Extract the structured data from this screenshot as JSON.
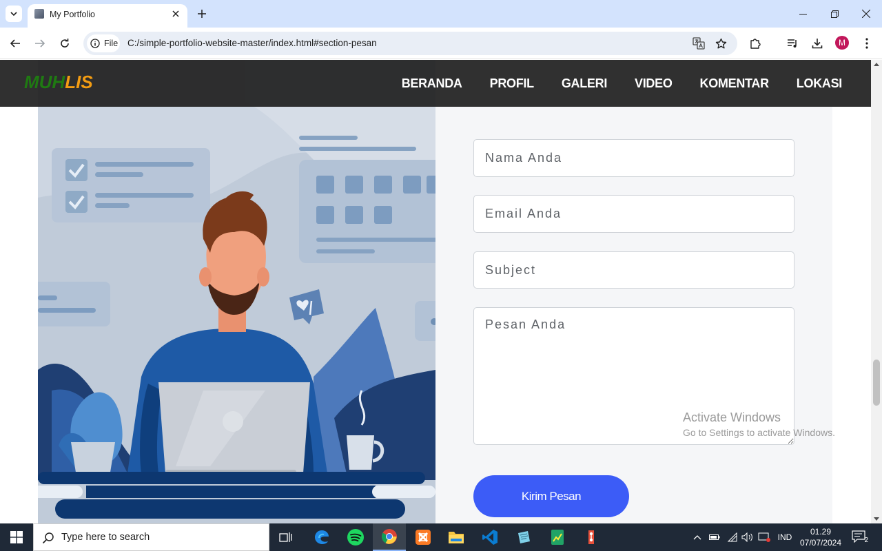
{
  "browser": {
    "tab_title": "My Portfolio",
    "site_chip_label": "File",
    "url": "C:/simple-portfolio-website-master/index.html#section-pesan",
    "profile_initial": "M"
  },
  "site": {
    "logo_part1": "MUH",
    "logo_part2": "LIS",
    "nav": [
      "BERANDA",
      "PROFIL",
      "GALERI",
      "VIDEO",
      "KOMENTAR",
      "LOKASI"
    ]
  },
  "form": {
    "name_placeholder": "Nama Anda",
    "email_placeholder": "Email Anda",
    "subject_placeholder": "Subject",
    "message_placeholder": "Pesan Anda",
    "submit_label": "Kirim Pesan"
  },
  "watermark": {
    "title": "Activate Windows",
    "subtitle": "Go to Settings to activate Windows."
  },
  "taskbar": {
    "search_placeholder": "Type here to search",
    "language": "IND",
    "time": "01.29",
    "date": "07/07/2024",
    "notification_count": "2"
  },
  "colors": {
    "nav_background": "#202020",
    "logo_green": "#1f7a12",
    "logo_orange": "#f39c12",
    "submit_button": "#3c5cf7",
    "form_panel": "#f5f6f8",
    "chrome_tabbar": "#d3e3fd",
    "taskbar": "#1f2937"
  },
  "icons": {
    "tabbar": [
      "tab-list-icon",
      "favicon-icon",
      "close-icon",
      "plus-icon",
      "minimize-icon",
      "maximize-icon",
      "window-close-icon"
    ],
    "toolbar": [
      "back-icon",
      "forward-icon",
      "reload-icon",
      "info-icon",
      "translate-icon",
      "star-icon",
      "extensions-icon",
      "media-icon",
      "download-icon",
      "menu-icon"
    ],
    "taskbar": [
      "windows-icon",
      "search-icon",
      "task-view-icon",
      "edge-icon",
      "spotify-icon",
      "chrome-icon",
      "xampp-icon",
      "file-explorer-icon",
      "vscode-icon",
      "notepad-icon",
      "sheets-icon",
      "git-icon",
      "chevron-up-icon",
      "battery-icon",
      "wifi-icon",
      "volume-icon",
      "display-icon",
      "notification-icon"
    ]
  }
}
